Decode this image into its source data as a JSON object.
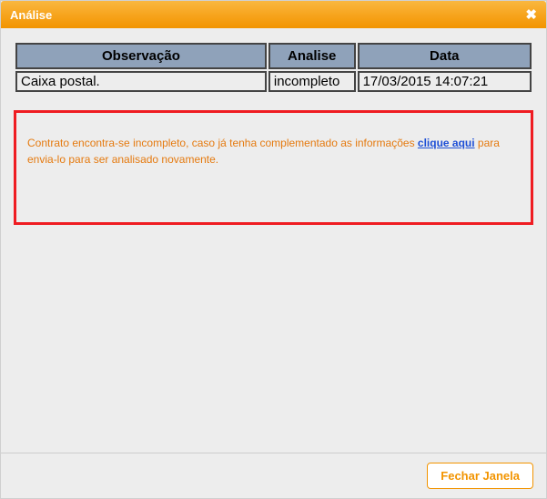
{
  "titlebar": {
    "title": "Análise",
    "close_symbol": "✖"
  },
  "table": {
    "headers": {
      "observacao": "Observação",
      "analise": "Analise",
      "data": "Data"
    },
    "row": {
      "observacao": "Caixa postal.",
      "analise": "incompleto",
      "data": "17/03/2015 14:07:21"
    }
  },
  "notice": {
    "text_before": "Contrato encontra-se incompleto, caso já tenha complementado as informações ",
    "link_text": "clique aqui",
    "text_after": " para envia-lo para ser analisado novamente."
  },
  "footer": {
    "close_button": "Fechar Janela"
  }
}
